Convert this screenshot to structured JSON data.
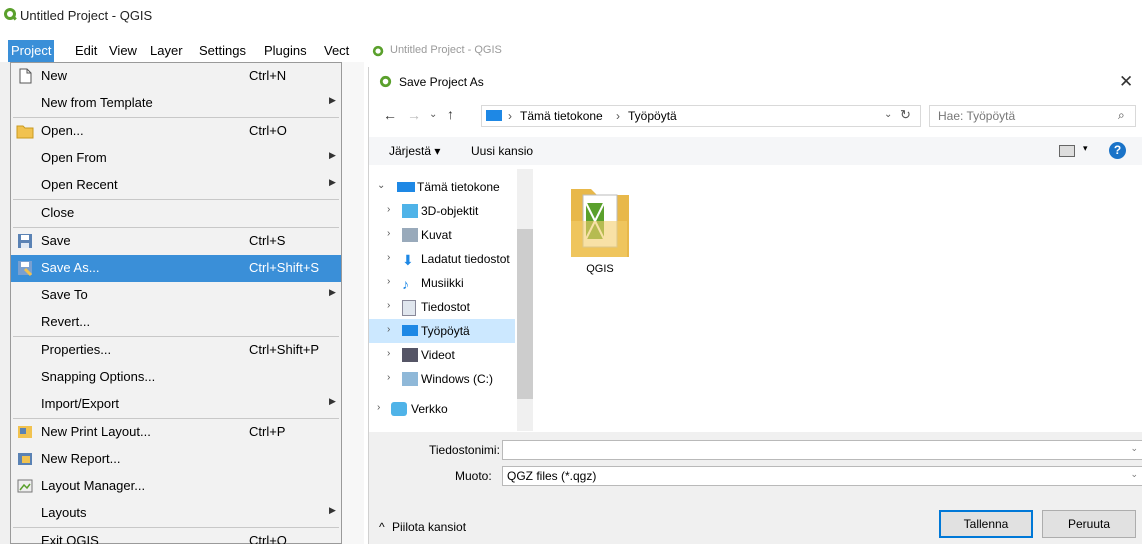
{
  "qgis_window": {
    "title": "Untitled Project - QGIS"
  },
  "menubar": {
    "items": [
      "Project",
      "Edit",
      "View",
      "Layer",
      "Settings",
      "Plugins",
      "Vect"
    ]
  },
  "project_menu": {
    "items": [
      {
        "label": "New",
        "shortcut": "Ctrl+N",
        "icon": "new-file-icon"
      },
      {
        "label": "New from Template",
        "shortcut": "",
        "submenu": true
      },
      {
        "label": "Open...",
        "shortcut": "Ctrl+O",
        "icon": "folder-icon"
      },
      {
        "label": "Open From",
        "shortcut": "",
        "submenu": true
      },
      {
        "label": "Open Recent",
        "shortcut": "",
        "submenu": true
      },
      {
        "label": "Close",
        "shortcut": ""
      },
      {
        "label": "Save",
        "shortcut": "Ctrl+S",
        "icon": "save-icon"
      },
      {
        "label": "Save As...",
        "shortcut": "Ctrl+Shift+S",
        "icon": "save-as-icon",
        "highlighted": true
      },
      {
        "label": "Save To",
        "shortcut": "",
        "submenu": true
      },
      {
        "label": "Revert...",
        "shortcut": ""
      },
      {
        "label": "Properties...",
        "shortcut": "Ctrl+Shift+P"
      },
      {
        "label": "Snapping Options...",
        "shortcut": ""
      },
      {
        "label": "Import/Export",
        "shortcut": "",
        "submenu": true
      },
      {
        "label": "New Print Layout...",
        "shortcut": "Ctrl+P",
        "icon": "print-layout-icon"
      },
      {
        "label": "New Report...",
        "shortcut": "",
        "icon": "report-icon"
      },
      {
        "label": "Layout Manager...",
        "shortcut": "",
        "icon": "layout-manager-icon"
      },
      {
        "label": "Layouts",
        "shortcut": "",
        "submenu": true
      },
      {
        "label": "Exit QGIS",
        "shortcut": "Ctrl+Q"
      }
    ]
  },
  "right_window": {
    "title": "Untitled Project - QGIS"
  },
  "save_dialog": {
    "title": "Save Project As",
    "breadcrumb": [
      "Tämä tietokone",
      "Työpöytä"
    ],
    "search_placeholder": "Hae: Työpöytä",
    "organize_label": "Järjestä ▾",
    "new_folder_label": "Uusi kansio",
    "tree": [
      {
        "label": "Tämä tietokone",
        "expanded": true,
        "level": 0
      },
      {
        "label": "3D-objektit",
        "level": 1
      },
      {
        "label": "Kuvat",
        "level": 1
      },
      {
        "label": "Ladatut tiedostot",
        "level": 1
      },
      {
        "label": "Musiikki",
        "level": 1
      },
      {
        "label": "Tiedostot",
        "level": 1
      },
      {
        "label": "Työpöytä",
        "level": 1,
        "selected": true
      },
      {
        "label": "Videot",
        "level": 1
      },
      {
        "label": "Windows (C:)",
        "level": 1
      },
      {
        "label": "Verkko",
        "level": 0
      }
    ],
    "files": [
      {
        "name": "QGIS",
        "type": "folder"
      }
    ],
    "filename_label": "Tiedostonimi:",
    "filename_value": "",
    "filetype_label": "Muoto:",
    "filetype_value": "QGZ files (*.qgz)",
    "hide_folders_label": "Piilota kansiot",
    "save_button": "Tallenna",
    "cancel_button": "Peruuta"
  },
  "colors": {
    "menu_highlight": "#3a8fd8",
    "tree_selected": "#cce8ff",
    "qgis_green": "#5aa02c"
  }
}
